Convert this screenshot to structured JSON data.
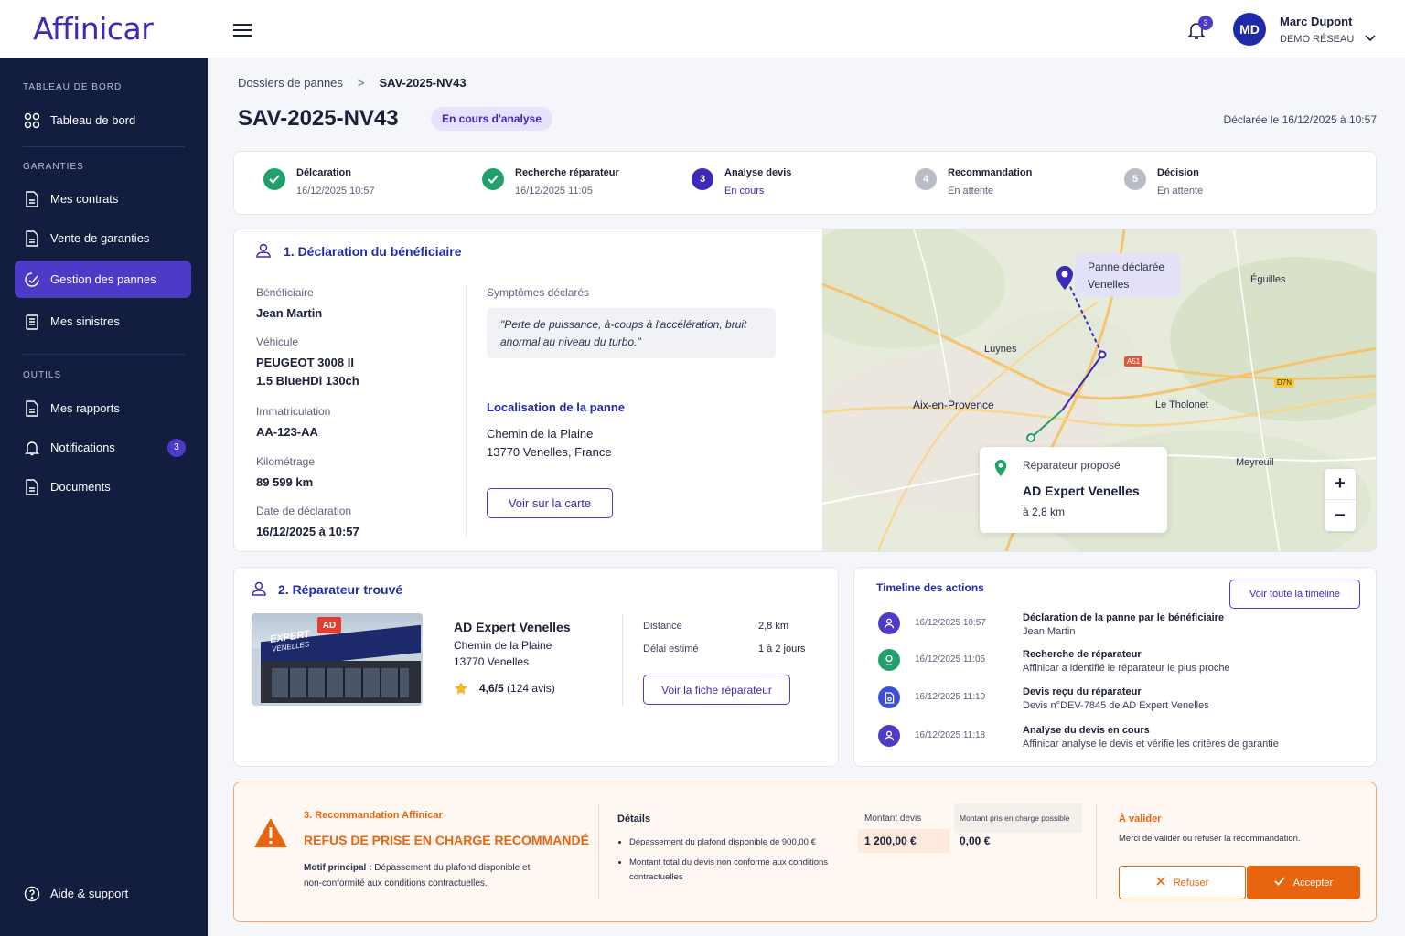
{
  "brand": {
    "logo": "Affinicar"
  },
  "sidebar": {
    "sections": [
      "TABLEAU DE BORD",
      "GARANTIES",
      "OUTILS"
    ],
    "items": [
      {
        "label": "Tableau de bord",
        "icon": "grid-icon"
      },
      {
        "label": "Mes contrats",
        "icon": "document-icon"
      },
      {
        "label": "Vente de garanties",
        "icon": "document-icon"
      },
      {
        "label": "Gestion des pannes",
        "icon": "wrench-icon"
      },
      {
        "label": "Mes sinistres",
        "icon": "clipboard-icon"
      },
      {
        "label": "Mes rapports",
        "icon": "document-icon"
      },
      {
        "label": "Notifications",
        "icon": "bell-icon",
        "badge": "3"
      },
      {
        "label": "Documents",
        "icon": "document-icon"
      }
    ],
    "help": "Aide & support"
  },
  "topbar": {
    "notif_count": "3",
    "avatar": "MD",
    "user_name": "Marc Dupont",
    "user_org": "DEMO RÉSEAU"
  },
  "breadcrumb": {
    "parent": "Dossiers de pannes",
    "sep": ">",
    "current": "SAV-2025-NV43"
  },
  "page": {
    "title": "SAV-2025-NV43",
    "status": "En cours d'analyse",
    "declared": "Déclarée le 16/12/2025 à 10:57"
  },
  "steps": [
    {
      "num": "1",
      "title": "Délcaration",
      "sub": "16/12/2025 10:57",
      "state": "done"
    },
    {
      "num": "2",
      "title": "Recherche réparateur",
      "sub": "16/12/2025 11:05",
      "state": "done"
    },
    {
      "num": "3",
      "title": "Analyse devis",
      "sub": "En cours",
      "state": "current"
    },
    {
      "num": "4",
      "title": "Recommandation",
      "sub": "En attente",
      "state": "pending"
    },
    {
      "num": "5",
      "title": "Décision",
      "sub": "En attente",
      "state": "pending"
    }
  ],
  "declaration": {
    "title": "1. Déclaration du bénéficiaire",
    "beneficiaire_label": "Bénéficiaire",
    "beneficiaire": "Jean Martin",
    "vehicule_label": "Véhicule",
    "vehicule_1": "PEUGEOT 3008 II",
    "vehicule_2": "1.5 BlueHDi 130ch",
    "immat_label": "Immatriculation",
    "immat": "AA-123-AA",
    "km_label": "Kilométrage",
    "km": "89 599 km",
    "date_label": "Date de déclaration",
    "date": "16/12/2025 à 10:57",
    "symptomes_label": "Symptômes déclarés",
    "symptomes": "\"Perte de puissance, à-coups à l'accélération, bruit anormal au niveau du turbo.\"",
    "loc_title": "Localisation de la panne",
    "loc_1": "Chemin de la Plaine",
    "loc_2": "13770 Venelles, France",
    "map_button": "Voir sur la carte"
  },
  "map": {
    "panne_1": "Panne déclarée",
    "panne_2": "Venelles",
    "towns": [
      "Éguilles",
      "Luynes",
      "Aix-en-Provence",
      "Le Tholonet",
      "Meyreuil"
    ],
    "roads": [
      "A51",
      "D7N"
    ],
    "rep_label": "Réparateur proposé",
    "rep_name": "AD Expert Venelles",
    "rep_dist": "à 2,8 km",
    "zoom_in": "+",
    "zoom_out": "−"
  },
  "repairer": {
    "title": "2. Réparateur trouvé",
    "photo_sign": "EXPERT",
    "photo_sub": "VENELLES",
    "photo_logo": "AD",
    "name": "AD Expert Venelles",
    "addr_1": "Chemin de la Plaine",
    "addr_2": "13770 Venelles",
    "rating": "4,6/5",
    "reviews": "(124 avis)",
    "distance_label": "Distance",
    "distance": "2,8 km",
    "delai_label": "Délai estimé",
    "delai": "1 à 2 jours",
    "button": "Voir la fiche réparateur"
  },
  "timeline": {
    "title": "Timeline des actions",
    "button": "Voir toute la timeline",
    "events": [
      {
        "time": "16/12/2025 10:57",
        "title": "Déclaration de la panne par le bénéficiaire",
        "desc": "Jean Martin",
        "color": "#4d3bc8"
      },
      {
        "time": "16/12/2025 11:05",
        "title": "Recherche de réparateur",
        "desc": "Affinicar a identifié le réparateur le plus proche",
        "color": "#22a06b"
      },
      {
        "time": "16/12/2025 11:10",
        "title": "Devis reçu du réparateur",
        "desc": "Devis n°DEV-7845 de AD Expert Venelles",
        "color": "#3b4fd8"
      },
      {
        "time": "16/12/2025 11:18",
        "title": "Analyse du devis en cours",
        "desc": "Affinicar analyse le devis et vérifie les critères de garantie",
        "color": "#4d3bc8"
      }
    ]
  },
  "recommendation": {
    "label": "3. Recommandation Affinicar",
    "headline": "REFUS DE PRISE EN CHARGE RECOMMANDÉ",
    "motif_label": "Motif principal :",
    "motif": "Dépassement du plafond disponible et non-conformité aux conditions contractuelles.",
    "details_title": "Détails",
    "details": [
      "Dépassement du plafond disponible de 900,00 €",
      "Montant total du devis non conforme aux conditions contractuelles"
    ],
    "montant_label": "Montant devis",
    "montant": "1 200,00 €",
    "prise_label": "Montant pris en charge possible",
    "prise": "0,00 €",
    "valider_title": "À valider",
    "valider_text": "Merci de valider ou refuser la recommandation.",
    "refuse": "Refuser",
    "accept": "Accepter"
  },
  "colors": {
    "primary": "#4d3bc8",
    "sidebar": "#131d3f",
    "success": "#22a06b",
    "warning": "#e8650f"
  }
}
